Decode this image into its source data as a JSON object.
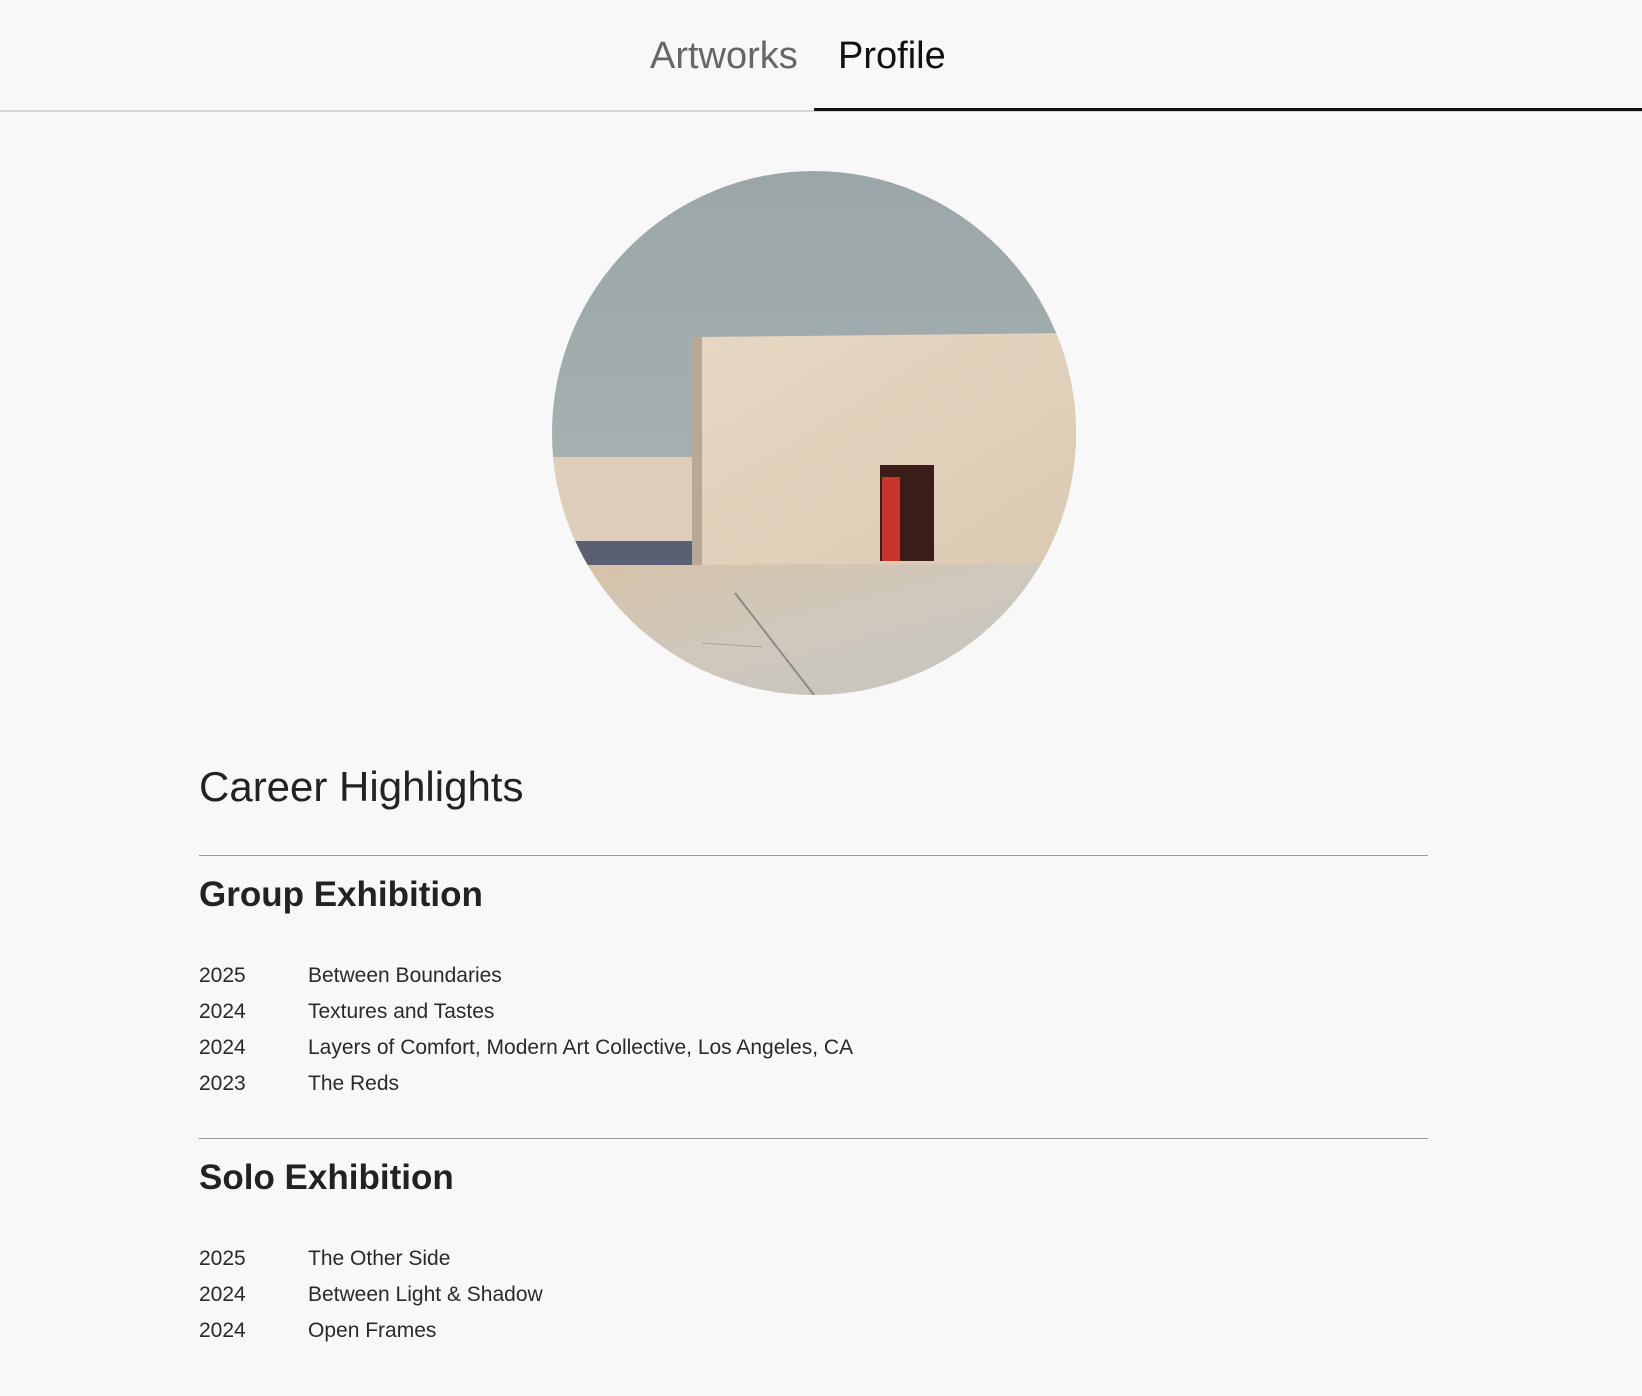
{
  "tabs": {
    "artworks_label": "Artworks",
    "profile_label": "Profile",
    "active": "Profile"
  },
  "profile": {
    "avatar_description": "painting of a beige building with a red door"
  },
  "career": {
    "title": "Career Highlights",
    "group": {
      "title": "Group Exhibition",
      "items": [
        {
          "year": "2025",
          "title": "Between Boundaries"
        },
        {
          "year": "2024",
          "title": "Textures and Tastes"
        },
        {
          "year": "2024",
          "title": "Layers of Comfort, Modern Art Collective, Los Angeles, CA"
        },
        {
          "year": "2023",
          "title": "The Reds"
        }
      ]
    },
    "solo": {
      "title": "Solo Exhibition",
      "items": [
        {
          "year": "2025",
          "title": "The Other Side"
        },
        {
          "year": "2024",
          "title": "Between Light & Shadow"
        },
        {
          "year": "2024",
          "title": "Open Frames"
        }
      ]
    }
  },
  "colors": {
    "background": "#f8f8f8",
    "text": "#222222",
    "tab_inactive": "#666666",
    "tab_active_indicator": "#111111",
    "divider": "#9a9a9a",
    "door_red": "#c8352a"
  }
}
